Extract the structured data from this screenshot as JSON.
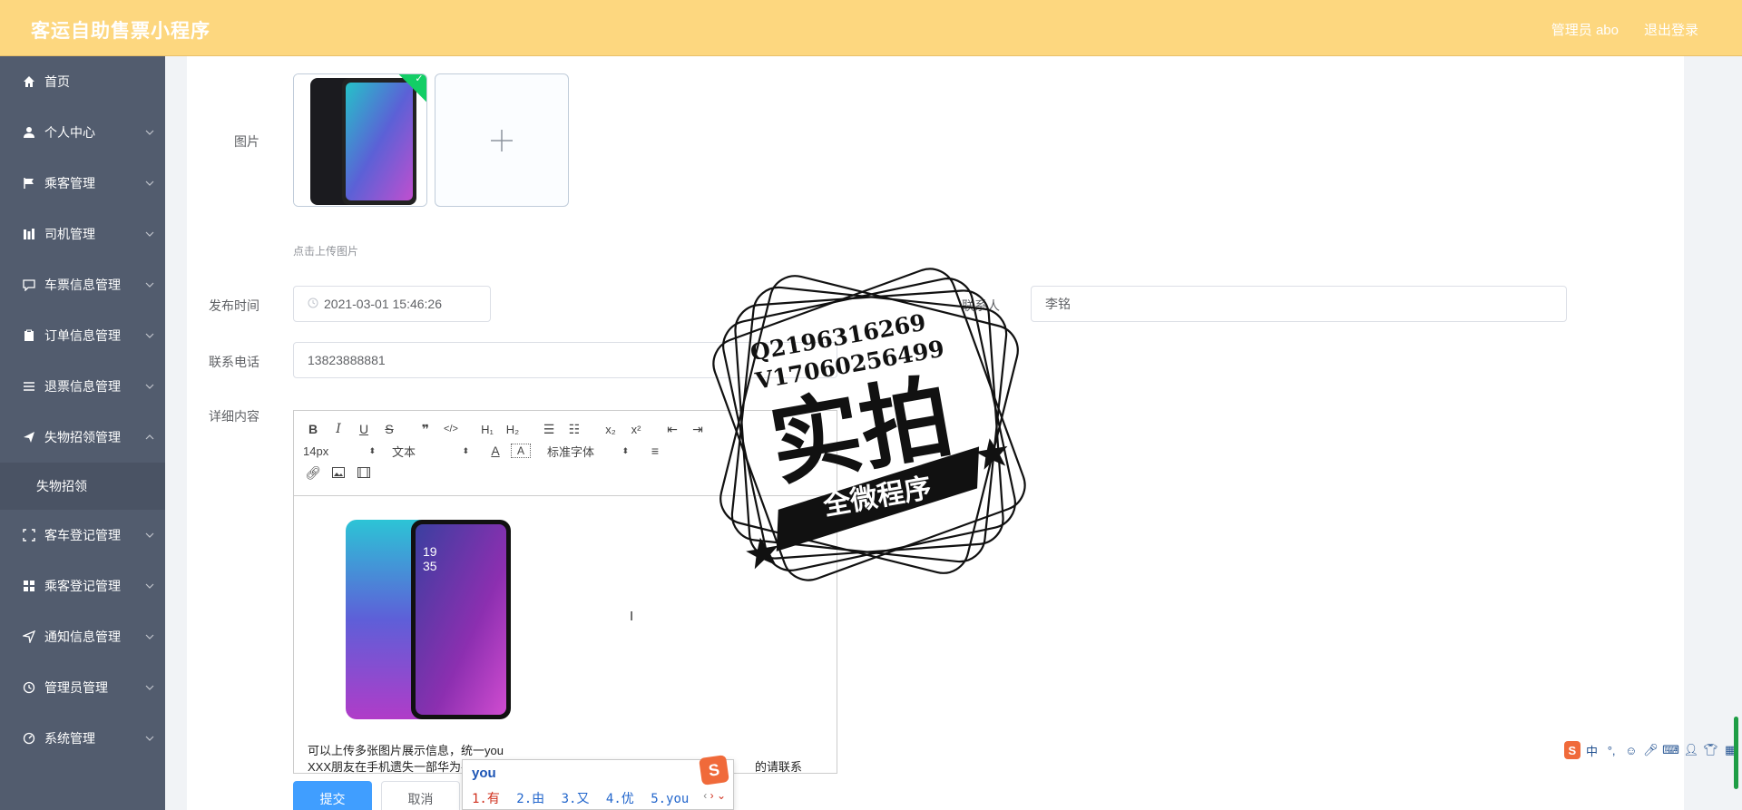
{
  "header": {
    "app_title": "客运自助售票小程序",
    "user_label": "管理员 abo",
    "logout_label": "退出登录"
  },
  "sidebar": {
    "items": [
      {
        "label": "首页",
        "icon": "home-icon"
      },
      {
        "label": "个人中心",
        "icon": "user-icon"
      },
      {
        "label": "乘客管理",
        "icon": "flag-icon"
      },
      {
        "label": "司机管理",
        "icon": "chart-icon"
      },
      {
        "label": "车票信息管理",
        "icon": "chat-icon"
      },
      {
        "label": "订单信息管理",
        "icon": "clipboard-icon"
      },
      {
        "label": "退票信息管理",
        "icon": "list-icon"
      },
      {
        "label": "失物招领管理",
        "icon": "send-icon"
      },
      {
        "label": "失物招领",
        "icon": ""
      },
      {
        "label": "客车登记管理",
        "icon": "scan-icon"
      },
      {
        "label": "乘客登记管理",
        "icon": "grid-icon"
      },
      {
        "label": "通知信息管理",
        "icon": "paper-plane-icon"
      },
      {
        "label": "管理员管理",
        "icon": "clock-icon"
      },
      {
        "label": "系统管理",
        "icon": "gauge-icon"
      }
    ]
  },
  "form": {
    "image_label": "图片",
    "upload_tip": "点击上传图片",
    "publish_time_label": "发布时间",
    "publish_time_value": "2021-03-01 15:46:26",
    "contact_person_label": "联系人",
    "contact_person_value": "李铭",
    "phone_label": "联系电话",
    "phone_value": "13823888881",
    "detail_label": "详细内容",
    "submit_label": "提交",
    "cancel_label": "取消"
  },
  "editor": {
    "font_size": "14px",
    "block_format": "文本",
    "font_family": "标准字体",
    "line1": "可以上传多张图片展示信息，统一you",
    "line2_start": "XXX朋友在手机遗失一部华为手机",
    "line2_end": "的请联系"
  },
  "ime": {
    "composition": "you",
    "candidates": [
      "1.有",
      "2.由",
      "3.又",
      "4.优",
      "5.you"
    ]
  },
  "watermark": {
    "line_q": "Q2196316269",
    "line_v": "V17060256499",
    "main_text": "实拍",
    "banner_text": "全微程序"
  },
  "ime_bar": {
    "mode_label": "中"
  }
}
